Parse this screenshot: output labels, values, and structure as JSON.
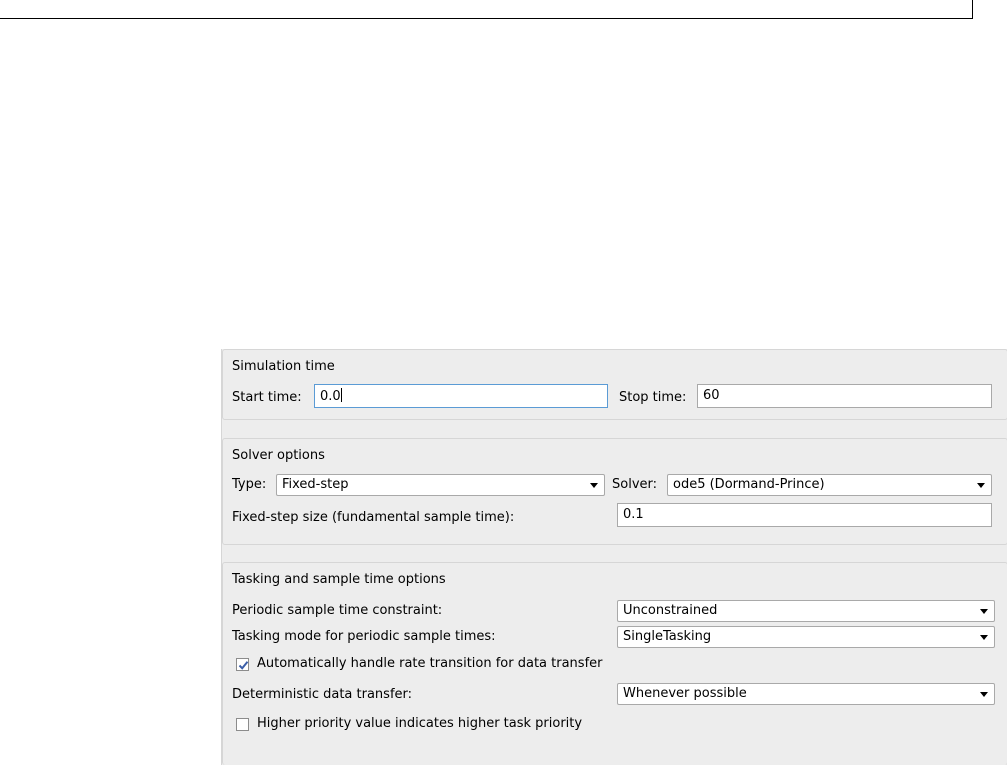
{
  "simulation_time": {
    "title": "Simulation time",
    "start_time_label": "Start time:",
    "start_time_value": "0.0",
    "stop_time_label": "Stop time:",
    "stop_time_value": "60"
  },
  "solver_options": {
    "title": "Solver options",
    "type_label": "Type:",
    "type_value": "Fixed-step",
    "solver_label": "Solver:",
    "solver_value": "ode5 (Dormand-Prince)",
    "step_size_label": "Fixed-step size (fundamental sample time):",
    "step_size_value": "0.1"
  },
  "tasking_options": {
    "title": "Tasking and sample time options",
    "periodic_constraint_label": "Periodic sample time constraint:",
    "periodic_constraint_value": "Unconstrained",
    "tasking_mode_label": "Tasking mode for periodic sample times:",
    "tasking_mode_value": "SingleTasking",
    "auto_rate_transition_label": "Automatically handle rate transition for data transfer",
    "auto_rate_transition_checked": true,
    "deterministic_transfer_label": "Deterministic data transfer:",
    "deterministic_transfer_value": "Whenever possible",
    "higher_priority_label": "Higher priority value indicates higher task priority",
    "higher_priority_checked": false
  },
  "colors": {
    "panel_background": "#ededed",
    "group_border": "#d6d6d6",
    "focus_border": "#5b9bd5",
    "check_mark": "#3b5ea8"
  }
}
